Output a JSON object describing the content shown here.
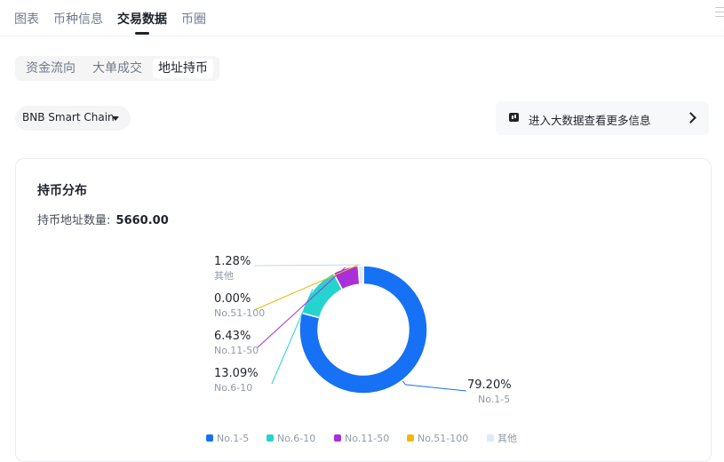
{
  "top_tabs": [
    "图表",
    "币种信息",
    "交易数据",
    "币圈"
  ],
  "sub_tabs": [
    "资金流向",
    "大单成交",
    "地址持币"
  ],
  "chain_select": {
    "value": "BNB Smart Chain"
  },
  "bigdata_link": {
    "label": "进入大数据查看更多信息"
  },
  "card": {
    "title": "持币分布",
    "address_count_label": "持币地址数量:",
    "address_count_value": "5660.00"
  },
  "chart_data": {
    "type": "pie",
    "donut": true,
    "series": [
      {
        "name": "No.1-5",
        "value": 79.2,
        "label": "79.20%",
        "color": "#1671f5"
      },
      {
        "name": "No.6-10",
        "value": 13.09,
        "label": "13.09%",
        "color": "#26d4cf"
      },
      {
        "name": "No.11-50",
        "value": 6.43,
        "label": "6.43%",
        "color": "#a92fd9"
      },
      {
        "name": "No.51-100",
        "value": 0.0,
        "label": "0.00%",
        "color": "#f0b90b"
      },
      {
        "name": "其他",
        "value": 1.28,
        "label": "1.28%",
        "color": "#dfe9f8"
      }
    ],
    "legend": [
      "No.1-5",
      "No.6-10",
      "No.11-50",
      "No.51-100",
      "其他"
    ],
    "legend_position": "bottom"
  }
}
